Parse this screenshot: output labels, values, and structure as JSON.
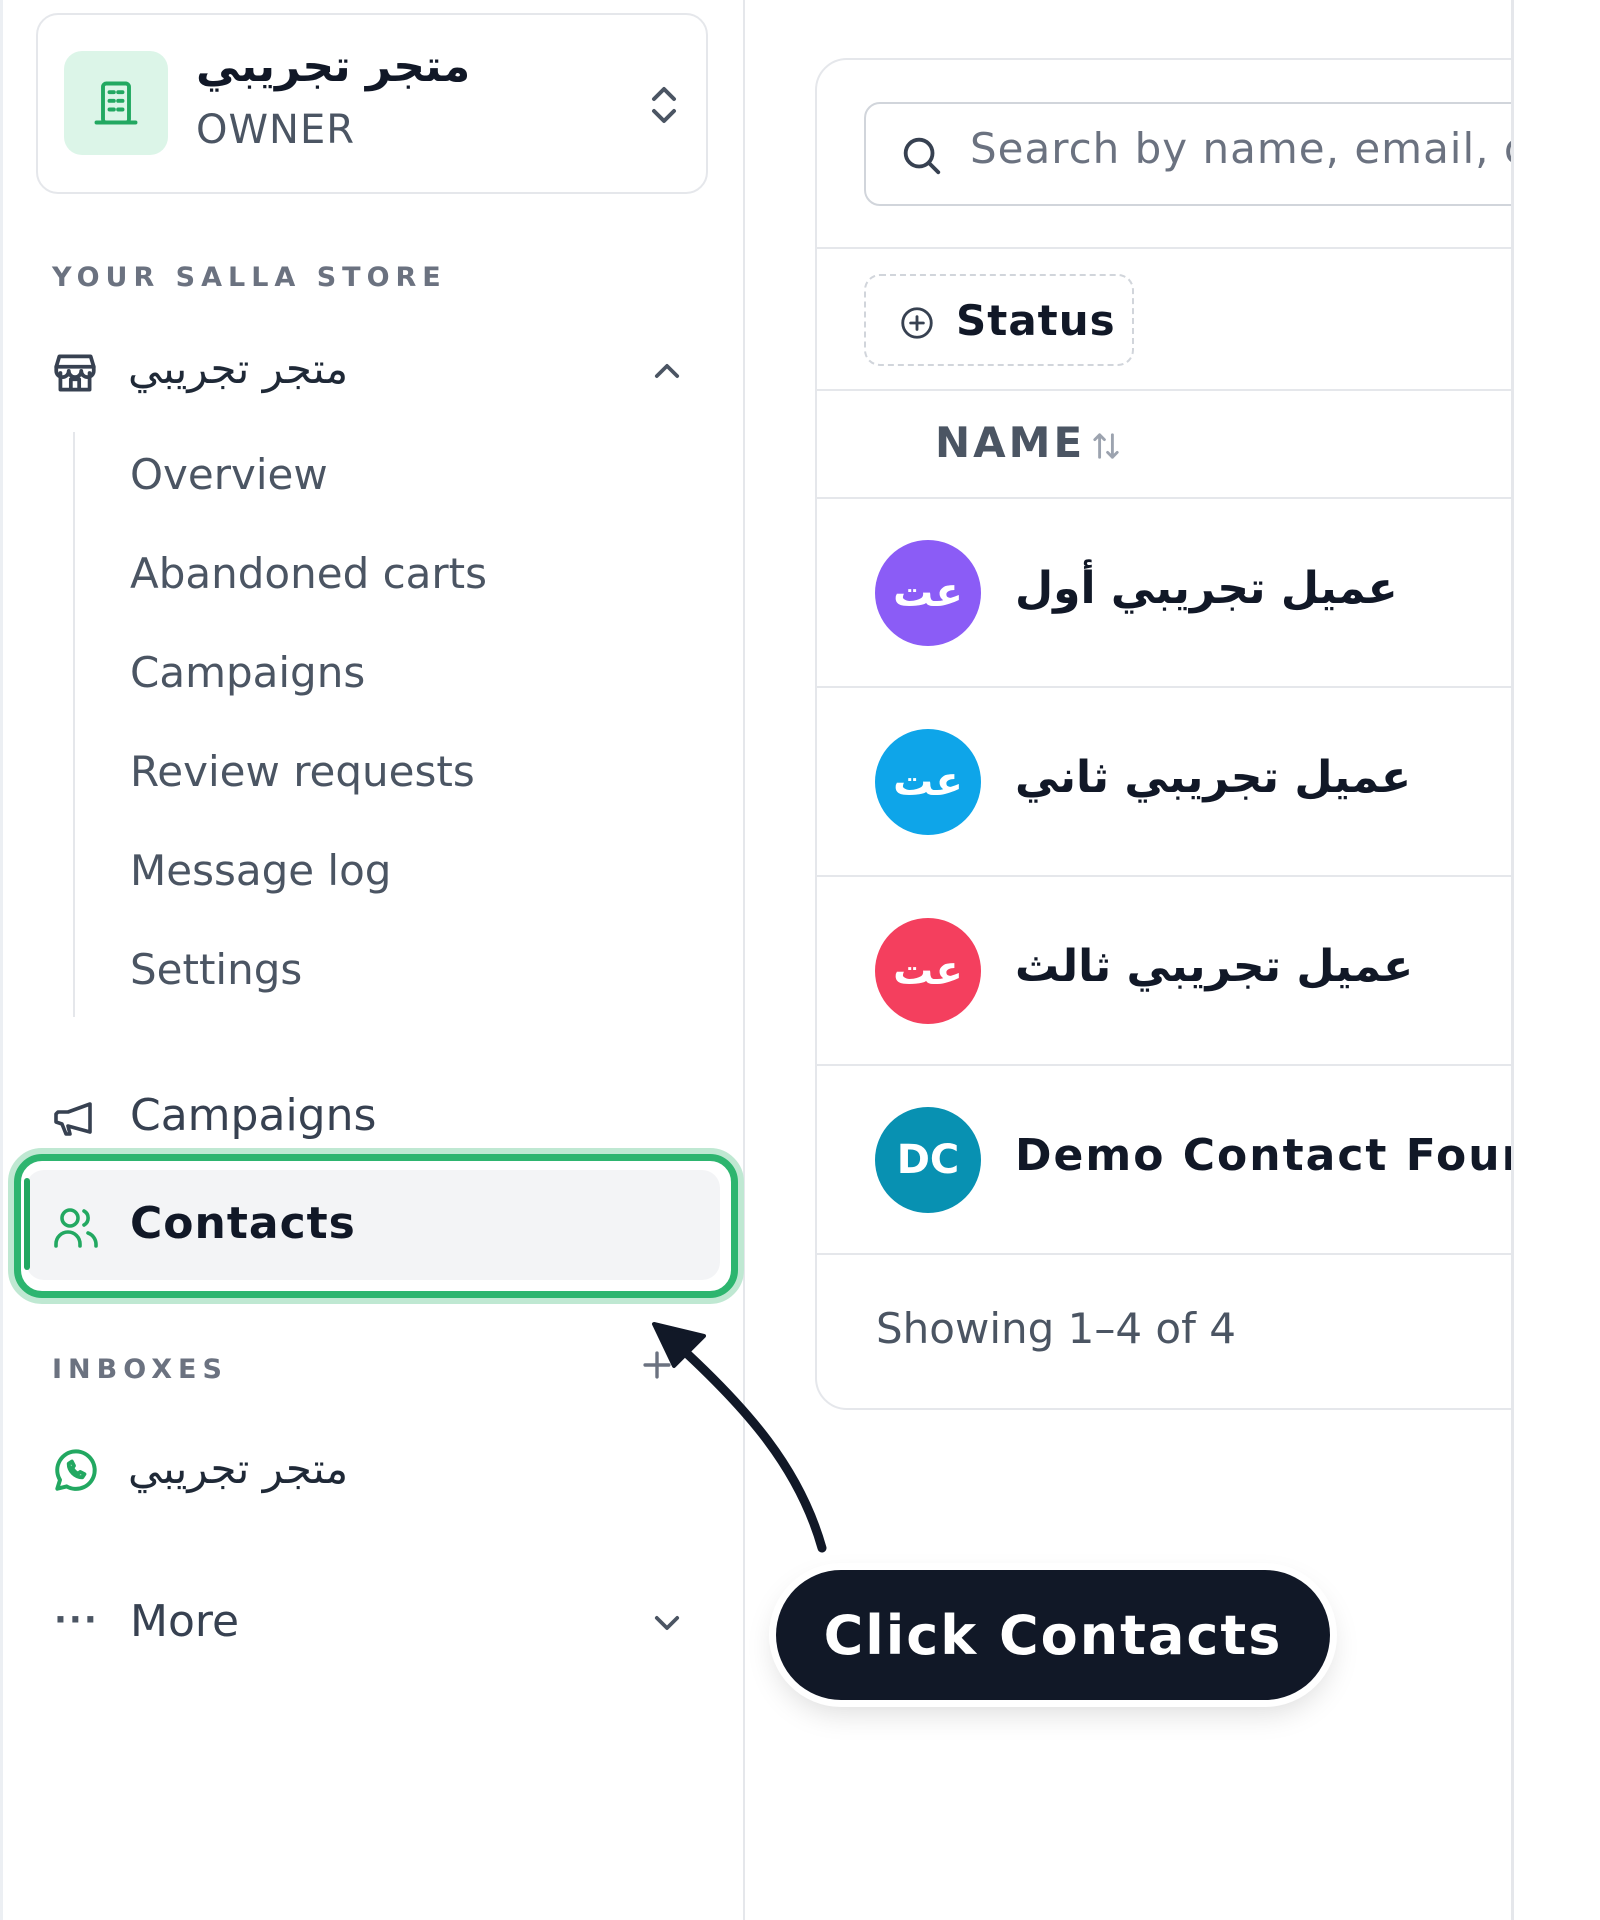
{
  "store_switcher": {
    "name": "متجر تجريبي",
    "role": "OWNER",
    "logo_icon": "building-icon",
    "toggle_icon": "chevron-up-down-icon"
  },
  "sidebar": {
    "section_store_label": "YOUR SALLA STORE",
    "store_group": {
      "label": "متجر تجريبي",
      "icon": "store-icon",
      "expanded": true
    },
    "store_sub_items": [
      {
        "label": "Overview"
      },
      {
        "label": "Abandoned carts"
      },
      {
        "label": "Campaigns"
      },
      {
        "label": "Review requests"
      },
      {
        "label": "Message log"
      },
      {
        "label": "Settings"
      }
    ],
    "campaigns": {
      "label": "Campaigns",
      "icon": "megaphone-icon"
    },
    "contacts": {
      "label": "Contacts",
      "icon": "users-icon",
      "active": true
    },
    "section_inboxes_label": "INBOXES",
    "inbox_item": {
      "label": "متجر تجريبي",
      "icon": "whatsapp-icon"
    },
    "more": {
      "label": "More",
      "icon": "ellipsis-icon"
    }
  },
  "contacts_panel": {
    "search_placeholder": "Search by name, email, or",
    "status_filter_label": "Status",
    "name_column_header": "NAME",
    "rows": [
      {
        "initials": "عت",
        "name": "عميل تجريبي أول",
        "avatar_color": "#8b5cf6"
      },
      {
        "initials": "عت",
        "name": "عميل تجريبي ثاني",
        "avatar_color": "#0ea5e9"
      },
      {
        "initials": "عت",
        "name": "عميل تجريبي ثالث",
        "avatar_color": "#f43f5e"
      },
      {
        "initials": "DC",
        "name": "Demo Contact Four",
        "avatar_color": "#0891b2"
      }
    ],
    "footer": "Showing 1–4 of 4"
  },
  "annotation": {
    "callout_text": "Click Contacts"
  },
  "colors": {
    "accent_green": "#2db56f",
    "callout_bg": "#111827"
  }
}
